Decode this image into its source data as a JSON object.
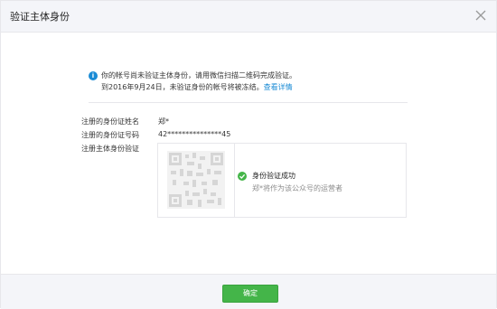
{
  "dialog": {
    "title": "验证主体身份"
  },
  "notice": {
    "line1": "你的帐号尚未验证主体身份，请用微信扫描二维码完成验证。",
    "line2": "到2016年9月24日，未验证身份的帐号将被冻结。",
    "link": "查看详情"
  },
  "fields": {
    "name_label": "注册的身份证姓名",
    "name_value": "郑*",
    "id_label": "注册的身份证号码",
    "id_value": "42***************45",
    "verify_label": "注册主体身份验证"
  },
  "verification": {
    "status": "身份验证成功",
    "detail": "郑*将作为该公众号的运营者"
  },
  "footer": {
    "confirm_label": "确定"
  },
  "colors": {
    "accent": "#44b549",
    "link": "#1a8bd5",
    "header_bg": "#f4f5f9"
  }
}
